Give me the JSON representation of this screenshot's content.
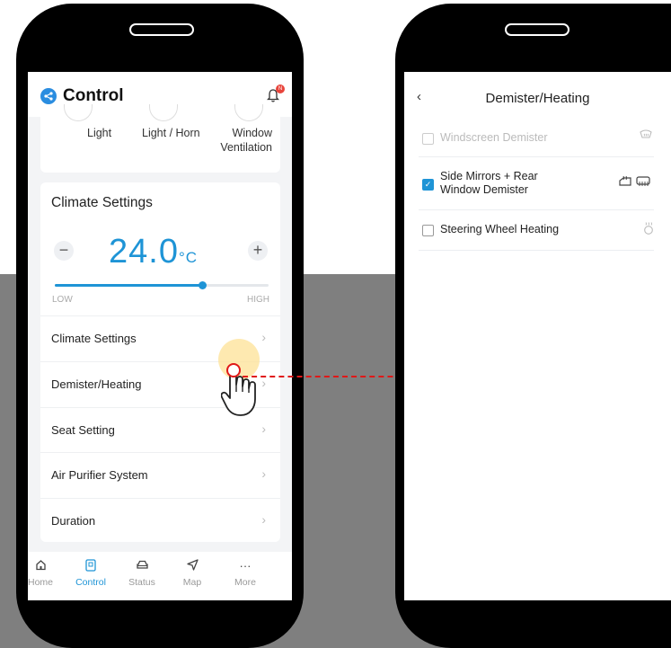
{
  "left_screen": {
    "app_title": "Control",
    "notification_badge": "N",
    "quick_buttons": [
      {
        "label": "Light"
      },
      {
        "label": "Light / Horn"
      },
      {
        "label": "Window Ventilation"
      }
    ],
    "climate": {
      "title": "Climate Settings",
      "minus_symbol": "−",
      "plus_symbol": "+",
      "temperature": "24.0",
      "unit": "°C",
      "slider_level": 0.69,
      "low_label": "LOW",
      "high_label": "HIGH"
    },
    "menu": [
      {
        "label": "Climate Settings"
      },
      {
        "label": "Demister/Heating"
      },
      {
        "label": "Seat Setting"
      },
      {
        "label": "Air Purifier System"
      },
      {
        "label": "Duration"
      }
    ],
    "tabs": [
      {
        "label": "Home",
        "icon": "home-icon",
        "active": false
      },
      {
        "label": "Control",
        "icon": "control-icon",
        "active": true
      },
      {
        "label": "Status",
        "icon": "car-icon",
        "active": false
      },
      {
        "label": "Map",
        "icon": "navigation-icon",
        "active": false
      },
      {
        "label": "More",
        "icon": "more-icon",
        "active": false
      }
    ]
  },
  "right_screen": {
    "title": "Demister/Heating",
    "options": [
      {
        "label": "Windscreen Demister",
        "checked": false,
        "enabled": false
      },
      {
        "label": "Side Mirrors + Rear Window Demister",
        "checked": true,
        "enabled": true
      },
      {
        "label": "Steering Wheel Heating",
        "checked": false,
        "enabled": true
      }
    ]
  },
  "colors": {
    "accent": "#1e94d6",
    "annotation_red": "#e01818",
    "tap_halo": "#fde296",
    "backdrop_gray": "#7f7f7f"
  }
}
